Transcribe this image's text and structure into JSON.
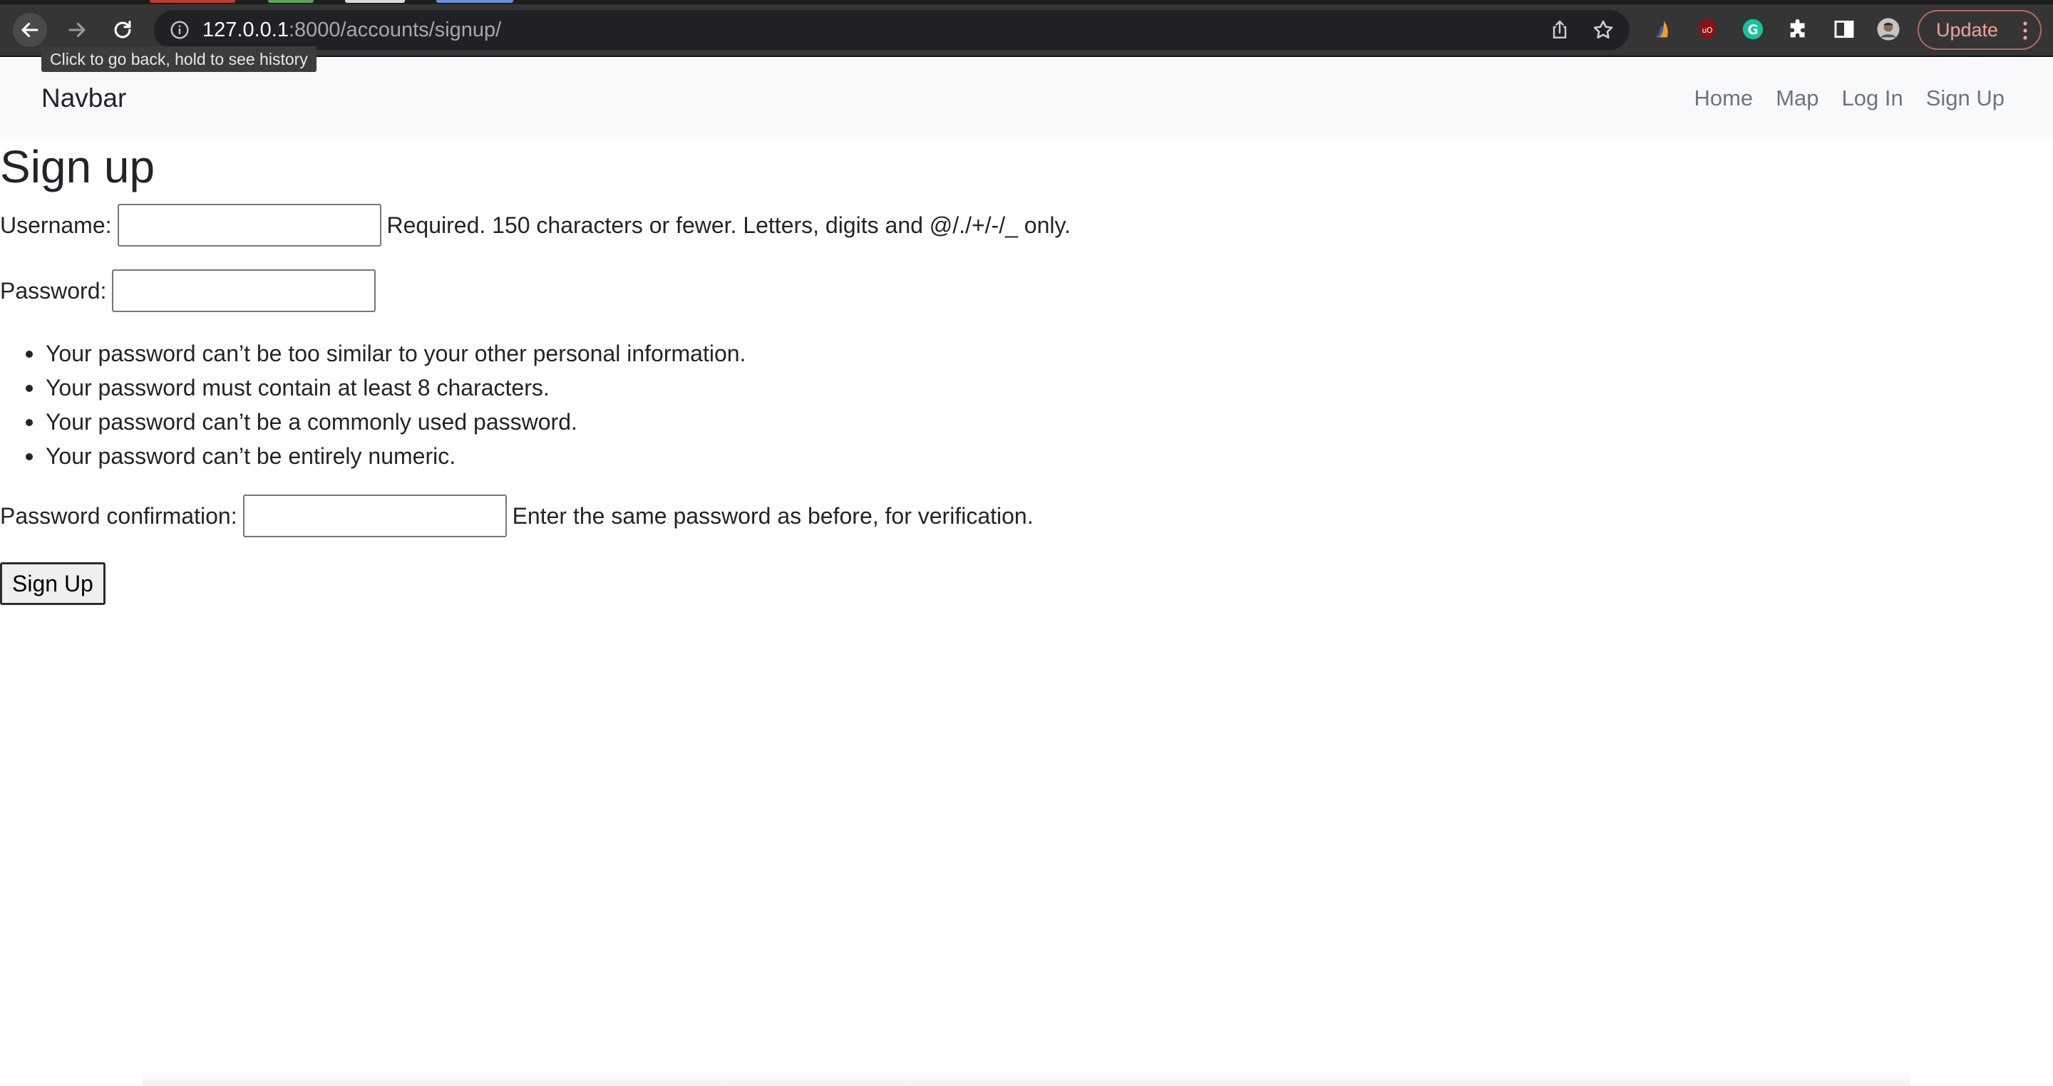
{
  "browser": {
    "url_host": "127.0.0.1",
    "url_path": ":8000/accounts/signup/",
    "tooltip": "Click to go back, hold to see history",
    "update_label": "Update",
    "extension_icons": [
      "arc-extension-icon",
      "ublock-origin-icon",
      "grammarly-icon",
      "puzzle-extensions-icon",
      "side-panel-icon",
      "profile-avatar-icon"
    ]
  },
  "navbar": {
    "brand": "Navbar",
    "links": [
      "Home",
      "Map",
      "Log In",
      "Sign Up"
    ]
  },
  "page": {
    "title": "Sign up",
    "username": {
      "label": "Username:",
      "value": "",
      "help": "Required. 150 characters or fewer. Letters, digits and @/./+/-/_ only."
    },
    "password": {
      "label": "Password:",
      "value": "",
      "rules": [
        "Your password can’t be too similar to your other personal information.",
        "Your password must contain at least 8 characters.",
        "Your password can’t be a commonly used password.",
        "Your password can’t be entirely numeric."
      ]
    },
    "password_confirmation": {
      "label": "Password confirmation:",
      "value": "",
      "help": "Enter the same password as before, for verification."
    },
    "submit_label": "Sign Up"
  },
  "colors": {
    "navbar_bg": "#f8f9fa",
    "nav_link": "#6c757d",
    "text": "#212529",
    "browser_toolbar": "#353535",
    "update_accent": "#f1a394"
  }
}
